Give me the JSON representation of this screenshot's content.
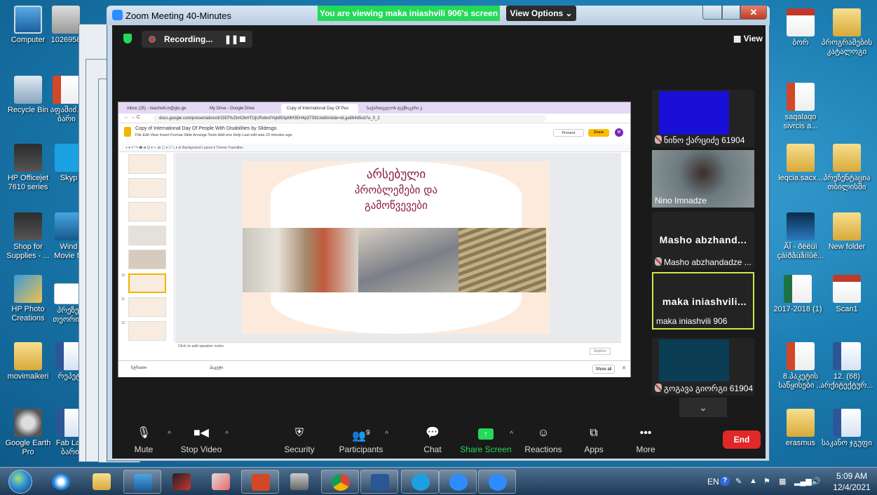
{
  "desktop": {
    "icons_left": [
      {
        "label": "Computer",
        "icon": "computer-icon"
      },
      {
        "label": "1026958",
        "icon": "generic-file-icon"
      },
      {
        "label": "Recycle Bin",
        "icon": "recycle-bin-icon"
      },
      {
        "label": "აფაშიძ... ბარი",
        "icon": "powerpoint-file-icon"
      },
      {
        "label": "HP Officejet 7610 series",
        "icon": "printer-icon"
      },
      {
        "label": "Skyp",
        "icon": "skype-icon"
      },
      {
        "label": "Shop for Supplies - ...",
        "icon": "printer-shop-icon"
      },
      {
        "label": "Wind Movie M",
        "icon": "movie-maker-icon"
      },
      {
        "label": "HP Photo Creations",
        "icon": "photo-icon"
      },
      {
        "label": "პრეზე თეორია",
        "icon": "slide-file-icon"
      },
      {
        "label": "movimaikeri",
        "icon": "folder-icon"
      },
      {
        "label": "რეპეტ",
        "icon": "word-file-icon"
      },
      {
        "label": "Google Earth Pro",
        "icon": "google-earth-icon"
      },
      {
        "label": "Fab Lab ბარი",
        "icon": "word-file-icon"
      }
    ],
    "icons_right": [
      {
        "label": "ბორ",
        "icon": "pdf-file-icon"
      },
      {
        "label": "პროგრამების კატალოგი",
        "icon": "zip-folder-icon"
      },
      {
        "label": "saqalaqo sivrcis a...",
        "icon": "powerpoint-file-icon"
      },
      {
        "label": "leqcia.sacx...",
        "icon": "zip-folder-icon"
      },
      {
        "label": "პრეზენტაცია თბილისში",
        "icon": "zip-folder-icon"
      },
      {
        "label": "ÃÎ - ðëëüì çàìðåùåííûé...",
        "icon": "video-file-icon"
      },
      {
        "label": "New folder",
        "icon": "folder-icon"
      },
      {
        "label": "2017-2018 (1)",
        "icon": "excel-file-icon"
      },
      {
        "label": "Scan1",
        "icon": "pdf-file-icon"
      },
      {
        "label": "8.პაკეტის საწყისები ...",
        "icon": "powerpoint-file-icon"
      },
      {
        "label": "12. (68) არქიტექტურ...",
        "icon": "word-file-icon"
      },
      {
        "label": "erasmus",
        "icon": "zip-folder-icon"
      },
      {
        "label": "საკანო ჯგუფი",
        "icon": "word-file-icon"
      }
    ]
  },
  "zoom": {
    "window_title": "Zoom Meeting 40-Minutes",
    "close_glyph": "✕",
    "share_banner": "You are viewing maka iniashvili 906's screen",
    "view_options": "View Options ⌄",
    "recording_label": "Recording...",
    "pause_glyph": "❚❚",
    "view_label": "View",
    "participants": [
      {
        "name": "ნინო ქარციძე 61904",
        "muted": true,
        "video_color": "#1a0fd6",
        "big_name": ""
      },
      {
        "name": "Nino Imnadze",
        "muted": false,
        "video_color": "#5c6a6e",
        "big_name": ""
      },
      {
        "name": "Masho abzhandadze ...",
        "muted": true,
        "video_color": "#232323",
        "big_name": "Masho  abzhand..."
      },
      {
        "name": "maka iniashvili 906",
        "muted": false,
        "video_color": "#232323",
        "big_name": "maka  iniashvili..."
      },
      {
        "name": "გოგავა გიორგი 61904",
        "muted": true,
        "video_color": "#0b3d55",
        "big_name": ""
      }
    ],
    "scroll_glyph": "⌄",
    "controls": [
      {
        "label": "Mute",
        "icon": "microphone-icon",
        "glyph": "🎙"
      },
      {
        "label": "Stop Video",
        "icon": "video-camera-icon",
        "glyph": "■◀"
      },
      {
        "label": "Security",
        "icon": "shield-icon",
        "glyph": "⛨"
      },
      {
        "label": "Participants",
        "icon": "participants-icon",
        "glyph": "👥",
        "count": "9"
      },
      {
        "label": "Chat",
        "icon": "chat-icon",
        "glyph": "💬"
      },
      {
        "label": "Share Screen",
        "icon": "share-screen-icon",
        "glyph": "↑"
      },
      {
        "label": "Reactions",
        "icon": "reactions-icon",
        "glyph": "☺"
      },
      {
        "label": "Apps",
        "icon": "apps-icon",
        "glyph": "⧉"
      },
      {
        "label": "More",
        "icon": "more-icon",
        "glyph": "•••"
      }
    ],
    "end_label": "End",
    "accent_green": "#23d959",
    "end_red": "#e02828"
  },
  "shared_screen": {
    "tabs": [
      {
        "label": "Inbox (25) - iniashvili.m@gtu.ge"
      },
      {
        "label": "My Drive - Google Drive"
      },
      {
        "label": "Copy of International Day Of Peo"
      },
      {
        "label": "საქართველოს ტექნიკური უ"
      }
    ],
    "url": "docs.google.com/presentation/d/15EFfvZbrtObHTOjURx6o0Yqk853pMH3EH4p37S81/edit#slide=id.ga564d5cb7a_0_2",
    "doc_title": "Copy of International Day Of People With Disabilities by Slidesgo",
    "doc_menu": "File   Edit   View   Insert   Format   Slide   Arrange   Tools   Add-ons   Help    Last edit was 23 minutes ago",
    "toolbar_text": "+  ▾  ↶  ↷  🖶  ⊕  Q ▾   ↖  ⊞  ▢ ▾  ⬠  ╲ ▾   ⊟   Background    Layout ▾    Theme    Transition",
    "present_label": "Present",
    "share_label": "Share",
    "avatar_letter": "M",
    "slide_numbers": [
      "",
      "",
      "",
      "",
      "",
      "10",
      "11",
      "12"
    ],
    "selected_slide": "10",
    "slide_title_lines": [
      "არსებული",
      "პრობლემები და",
      "გამოწვევები"
    ],
    "speaker_notes": "Click to add speaker notes",
    "explore_label": "Explore",
    "downloads": [
      {
        "label": "სურათი"
      },
      {
        "label": "პაკეტი"
      }
    ],
    "show_all": "Show all",
    "dl_close": "✕"
  },
  "taskbar": {
    "apps": [
      {
        "icon": "internet-explorer-icon"
      },
      {
        "icon": "file-explorer-icon"
      },
      {
        "icon": "media-player-icon"
      },
      {
        "icon": "archicad-icon"
      },
      {
        "icon": "paint-tool-icon"
      },
      {
        "icon": "powerpoint-icon"
      },
      {
        "icon": "scanner-icon"
      },
      {
        "icon": "chrome-icon"
      },
      {
        "icon": "word-icon"
      },
      {
        "icon": "skype-icon"
      },
      {
        "icon": "zoom-icon"
      },
      {
        "icon": "zoom-icon"
      }
    ],
    "lang": "EN",
    "help_glyph": "?",
    "time": "5:09 AM",
    "date": "12/4/2021"
  }
}
